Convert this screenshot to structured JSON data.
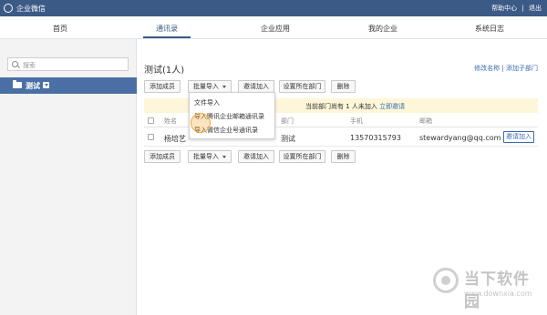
{
  "header": {
    "app_title": "企业微信",
    "help": "帮助中心",
    "separator": "|",
    "logout": "退出"
  },
  "nav": {
    "tabs": [
      {
        "label": "首页"
      },
      {
        "label": "通讯录"
      },
      {
        "label": "企业应用"
      },
      {
        "label": "我的企业"
      },
      {
        "label": "系统日志"
      }
    ],
    "active_tab": "通讯录"
  },
  "sidebar": {
    "search_placeholder": "搜索",
    "department": "测试"
  },
  "main": {
    "title": "测试(1人)",
    "links": {
      "edit_name": "修改名称",
      "separator": "|",
      "add_sub": "添加子部门"
    },
    "toolbar": {
      "add_member": "添加成员",
      "batch_import": "批量导入",
      "invite": "邀请加入",
      "set_dept": "设置所在部门",
      "delete": "删除"
    },
    "dropdown": {
      "items": [
        {
          "label": "文件导入"
        },
        {
          "label": "导入腾讯企业邮箱通讯录"
        },
        {
          "label": "导入微信企业号通讯录"
        }
      ]
    },
    "notice": {
      "text": "当前部门尚有 1 人未加入",
      "link": "立即邀请"
    },
    "table": {
      "headers": {
        "name": "姓名",
        "dept": "部门",
        "phone": "手机",
        "email": "邮箱"
      },
      "rows": [
        {
          "name": "杨培艺",
          "dept": "测试",
          "phone": "13570315793",
          "email": "stewardyang@qq.com",
          "action": "邀请加入"
        }
      ]
    }
  },
  "watermark": {
    "title": "当下软件园",
    "url": "www.downxia.com"
  },
  "colors": {
    "header_bg": "#3b5a86",
    "accent": "#4a6fa5",
    "link": "#3b6bb0",
    "notice_bg": "#fdf6d8",
    "highlight": "#f0a43a"
  }
}
